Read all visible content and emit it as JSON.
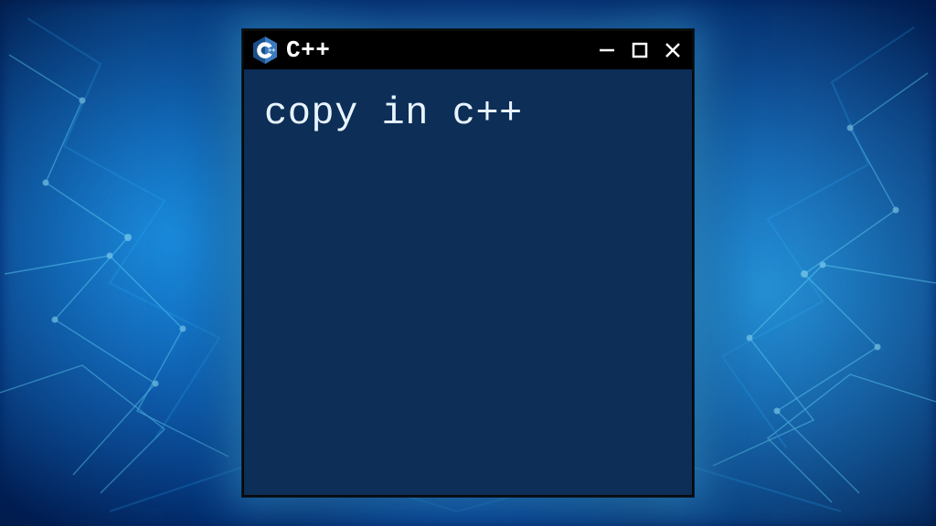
{
  "window": {
    "title": "C++",
    "content_text": "copy in c++"
  },
  "colors": {
    "window_bg": "#0c2e57",
    "titlebar_bg": "#000000",
    "text": "#e8f4ff"
  }
}
